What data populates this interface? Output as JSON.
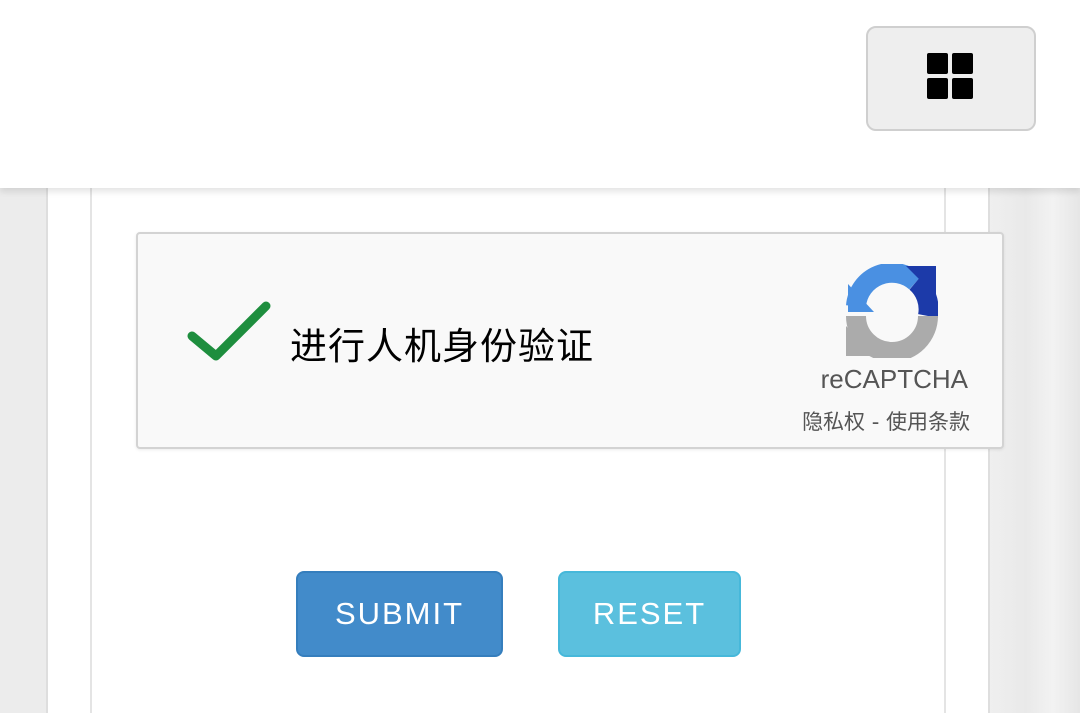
{
  "header": {
    "menu_icon": "grid-icon"
  },
  "recaptcha": {
    "label": "进行人机身份验证",
    "checked": true,
    "check_color": "#1e8e3e",
    "brand": "reCAPTCHA",
    "privacy_link": "隐私权",
    "separator": " - ",
    "terms_link": "使用条款",
    "logo_icon": "recaptcha-logo-icon"
  },
  "form": {
    "submit_label": "SUBMIT",
    "reset_label": "RESET"
  },
  "colors": {
    "submit": "#428bca",
    "reset": "#5bc0de"
  }
}
